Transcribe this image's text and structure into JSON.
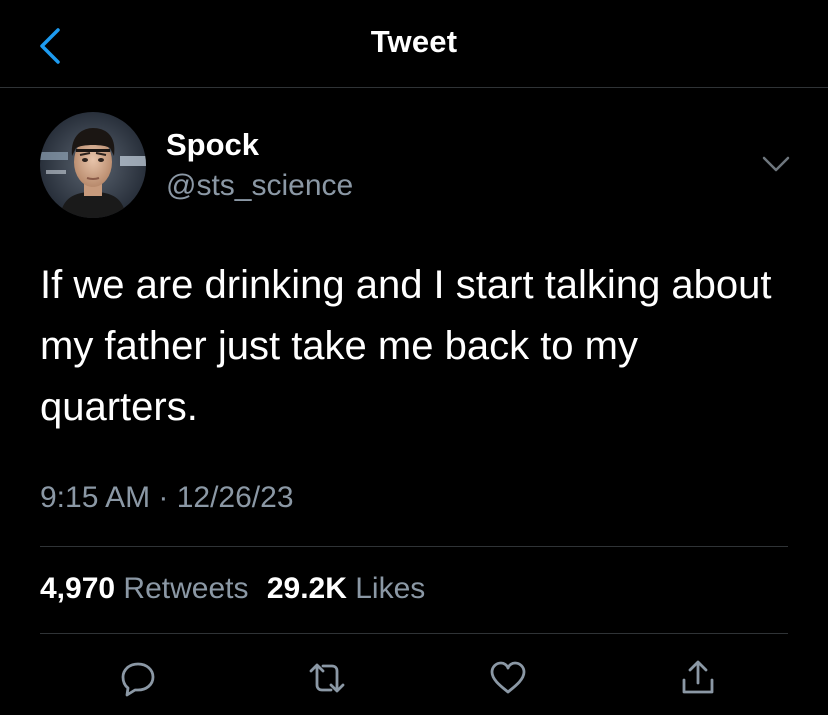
{
  "header": {
    "title": "Tweet",
    "back_icon": "chevron-left-icon",
    "accent_color": "#1d9bf0"
  },
  "tweet": {
    "author": {
      "display_name": "Spock",
      "handle": "@sts_science"
    },
    "text": "If we are drinking and I start talking about my father just take me back to my quarters.",
    "timestamp": "9:15 AM · 12/26/23",
    "stats": {
      "retweets_count": "4,970",
      "retweets_label": "Retweets",
      "likes_count": "29.2K",
      "likes_label": "Likes"
    },
    "actions": [
      "reply-icon",
      "retweet-icon",
      "like-icon",
      "share-icon"
    ]
  },
  "colors": {
    "background": "#000000",
    "text_primary": "#ffffff",
    "text_secondary": "#8b98a5",
    "divider": "#2f3336"
  }
}
